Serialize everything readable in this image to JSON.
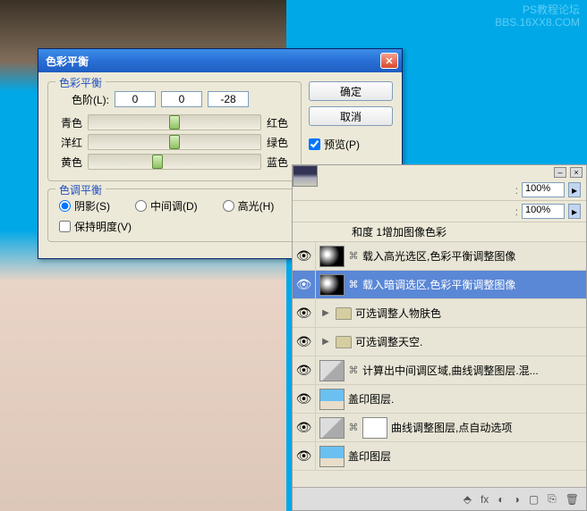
{
  "watermark": {
    "line1": "PS教程论坛",
    "line2": "BBS.16XX8.COM"
  },
  "dialog": {
    "title": "色彩平衡",
    "ok": "确定",
    "cancel": "取消",
    "preview": "预览(P)",
    "group1": {
      "legend": "色彩平衡",
      "levels_label": "色阶(L):",
      "levels": [
        "0",
        "0",
        "-28"
      ],
      "sliders": [
        {
          "left": "青色",
          "right": "红色",
          "pos": 50
        },
        {
          "left": "洋红",
          "right": "绿色",
          "pos": 50
        },
        {
          "left": "黄色",
          "right": "蓝色",
          "pos": 40
        }
      ]
    },
    "group2": {
      "legend": "色调平衡",
      "shadows": "阴影(S)",
      "midtones": "中间调(D)",
      "highlights": "高光(H)",
      "preserve": "保持明度(V)"
    }
  },
  "layers_panel": {
    "opacity1": "100%",
    "opacity2": "100%",
    "caption": "和度 1增加图像色彩",
    "items": [
      {
        "type": "adjust",
        "name": "载入高光选区,色彩平衡调整图像",
        "sel": false
      },
      {
        "type": "adjust",
        "name": "载入暗调选区,色彩平衡调整图像",
        "sel": true
      },
      {
        "type": "folder",
        "name": "可选调整人物肤色"
      },
      {
        "type": "folder",
        "name": "可选调整天空."
      },
      {
        "type": "curve",
        "name": "计算出中间调区域,曲线调整图层.混..."
      },
      {
        "type": "image",
        "name": "盖印图层."
      },
      {
        "type": "curve2",
        "name": "曲线调整图层,点自动选项"
      },
      {
        "type": "image",
        "name": "盖印图层"
      }
    ],
    "bottom_icons": [
      "❐",
      "⬢",
      "fx",
      "◐",
      "◪",
      "▦",
      "⌇",
      "◌"
    ]
  }
}
